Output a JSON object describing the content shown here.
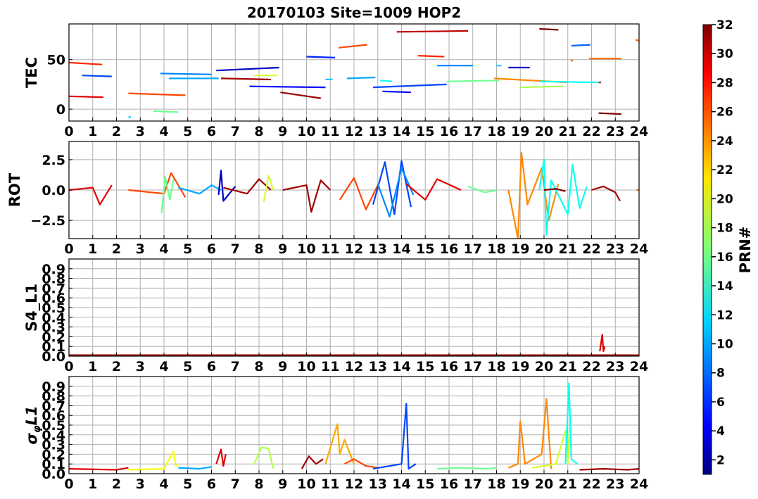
{
  "title": "20170103 Site=1009 HOP2",
  "colorbar": {
    "label": "PRN#",
    "min": 1,
    "max": 32,
    "ticks": [
      2,
      4,
      6,
      8,
      10,
      12,
      14,
      16,
      18,
      20,
      22,
      24,
      26,
      28,
      30,
      32
    ],
    "colormap": "jet"
  },
  "chart_data": [
    {
      "type": "line",
      "id": "tec",
      "ylabel": "TEC",
      "xlim": [
        0,
        24
      ],
      "ylim": [
        -12,
        86
      ],
      "xticks": [
        0,
        1,
        2,
        3,
        4,
        5,
        6,
        7,
        8,
        9,
        10,
        11,
        12,
        13,
        14,
        15,
        16,
        17,
        18,
        19,
        20,
        21,
        22,
        23,
        24
      ],
      "yticks": [
        0,
        50
      ],
      "ytick_labels": [
        "0",
        "50"
      ],
      "grid": true,
      "series": [
        {
          "prn": 27,
          "x": [
            0.0,
            1.4
          ],
          "y": [
            47,
            45
          ]
        },
        {
          "prn": 29,
          "x": [
            0.0,
            1.45
          ],
          "y": [
            13,
            12
          ]
        },
        {
          "prn": 7,
          "x": [
            0.55,
            1.8
          ],
          "y": [
            34,
            33
          ]
        },
        {
          "prn": 11,
          "x": [
            2.5,
            2.6
          ],
          "y": [
            -8,
            -8
          ]
        },
        {
          "prn": 26,
          "x": [
            2.5,
            4.9
          ],
          "y": [
            16,
            14
          ]
        },
        {
          "prn": 16,
          "x": [
            3.55,
            4.6
          ],
          "y": [
            -2,
            -3
          ]
        },
        {
          "prn": 9,
          "x": [
            3.85,
            6.0
          ],
          "y": [
            36,
            35
          ]
        },
        {
          "prn": 10,
          "x": [
            4.2,
            6.3
          ],
          "y": [
            31,
            31
          ]
        },
        {
          "prn": 3,
          "x": [
            6.2,
            8.85
          ],
          "y": [
            39,
            42
          ]
        },
        {
          "prn": 31,
          "x": [
            6.4,
            8.5
          ],
          "y": [
            31,
            30
          ]
        },
        {
          "prn": 19,
          "x": [
            7.8,
            8.8
          ],
          "y": [
            34,
            34
          ]
        },
        {
          "prn": 5,
          "x": [
            7.6,
            10.8
          ],
          "y": [
            23,
            22
          ]
        },
        {
          "prn": 31,
          "x": [
            8.9,
            10.6
          ],
          "y": [
            17,
            11
          ]
        },
        {
          "prn": 6,
          "x": [
            10.0,
            11.2
          ],
          "y": [
            53,
            52
          ]
        },
        {
          "prn": 26,
          "x": [
            11.35,
            12.55
          ],
          "y": [
            62,
            65
          ]
        },
        {
          "prn": 11,
          "x": [
            10.8,
            11.1
          ],
          "y": [
            30,
            30
          ]
        },
        {
          "prn": 10,
          "x": [
            11.7,
            12.9
          ],
          "y": [
            31,
            32
          ]
        },
        {
          "prn": 7,
          "x": [
            12.8,
            15.9
          ],
          "y": [
            22,
            25
          ]
        },
        {
          "prn": 13,
          "x": [
            13.1,
            13.6
          ],
          "y": [
            29,
            28
          ]
        },
        {
          "prn": 5,
          "x": [
            13.2,
            14.4
          ],
          "y": [
            18,
            17
          ]
        },
        {
          "prn": 30,
          "x": [
            13.8,
            16.8
          ],
          "y": [
            78,
            79
          ]
        },
        {
          "prn": 27,
          "x": [
            14.7,
            15.8
          ],
          "y": [
            54,
            53
          ]
        },
        {
          "prn": 9,
          "x": [
            15.5,
            17.0
          ],
          "y": [
            44,
            44
          ]
        },
        {
          "prn": 16,
          "x": [
            15.9,
            18.1
          ],
          "y": [
            28,
            29
          ]
        },
        {
          "prn": 11,
          "x": [
            18.0,
            18.2
          ],
          "y": [
            44,
            44
          ]
        },
        {
          "prn": 24,
          "x": [
            17.9,
            21.0
          ],
          "y": [
            31,
            27
          ]
        },
        {
          "prn": 3,
          "x": [
            18.5,
            19.4
          ],
          "y": [
            42,
            42
          ]
        },
        {
          "prn": 18,
          "x": [
            19.0,
            20.8
          ],
          "y": [
            22,
            23
          ]
        },
        {
          "prn": 13,
          "x": [
            19.8,
            22.3
          ],
          "y": [
            28,
            27
          ]
        },
        {
          "prn": 32,
          "x": [
            19.8,
            20.6
          ],
          "y": [
            81,
            80
          ]
        },
        {
          "prn": 8,
          "x": [
            21.15,
            21.95
          ],
          "y": [
            64,
            65
          ]
        },
        {
          "prn": 25,
          "x": [
            21.15,
            21.2
          ],
          "y": [
            48,
            50
          ]
        },
        {
          "prn": 25,
          "x": [
            21.9,
            23.25
          ],
          "y": [
            51,
            51
          ]
        },
        {
          "prn": 30,
          "x": [
            22.3,
            22.4
          ],
          "y": [
            27,
            27
          ]
        },
        {
          "prn": 32,
          "x": [
            22.3,
            23.25
          ],
          "y": [
            -4,
            -5
          ]
        },
        {
          "prn": 25,
          "x": [
            23.85,
            24.0
          ],
          "y": [
            70,
            69
          ]
        }
      ]
    },
    {
      "type": "line",
      "id": "rot",
      "ylabel": "ROT",
      "xlim": [
        0,
        24
      ],
      "ylim": [
        -4,
        4
      ],
      "xticks": [
        0,
        1,
        2,
        3,
        4,
        5,
        6,
        7,
        8,
        9,
        10,
        11,
        12,
        13,
        14,
        15,
        16,
        17,
        18,
        19,
        20,
        21,
        22,
        23,
        24
      ],
      "yticks": [
        -2.5,
        0.0,
        2.5
      ],
      "ytick_labels": [
        "−2.5",
        "0.0",
        "2.5"
      ],
      "grid": true,
      "series": [
        {
          "prn": 29,
          "x": [
            0,
            1.0,
            1.3,
            1.8
          ],
          "y": [
            0,
            0.2,
            -1.2,
            0.4
          ]
        },
        {
          "prn": 26,
          "x": [
            2.5,
            4.0,
            4.3,
            4.9
          ],
          "y": [
            0,
            -0.3,
            1.4,
            -0.6
          ]
        },
        {
          "prn": 16,
          "x": [
            3.9,
            4.05,
            4.25,
            4.4
          ],
          "y": [
            -1.9,
            1.1,
            -0.8,
            0.9
          ]
        },
        {
          "prn": 10,
          "x": [
            4.6,
            5.5,
            6.0,
            6.4
          ],
          "y": [
            0.2,
            -0.3,
            0.4,
            0
          ]
        },
        {
          "prn": 3,
          "x": [
            6.3,
            6.4,
            6.5,
            7.0
          ],
          "y": [
            -0.4,
            1.6,
            -0.9,
            0.3
          ]
        },
        {
          "prn": 31,
          "x": [
            6.5,
            7.5,
            8.0,
            8.5
          ],
          "y": [
            0.2,
            -0.3,
            0.9,
            0
          ]
        },
        {
          "prn": 19,
          "x": [
            8.2,
            8.4,
            8.6
          ],
          "y": [
            -1.0,
            1.2,
            0
          ]
        },
        {
          "prn": 31,
          "x": [
            9.0,
            10.0,
            10.2,
            10.6,
            11.0
          ],
          "y": [
            0,
            0.4,
            -1.8,
            0.8,
            0
          ]
        },
        {
          "prn": 26,
          "x": [
            11.4,
            12.0,
            12.5,
            13.0
          ],
          "y": [
            -0.8,
            1.0,
            -1.6,
            0.4
          ]
        },
        {
          "prn": 7,
          "x": [
            12.8,
            13.3,
            13.7,
            14.0,
            14.4
          ],
          "y": [
            -1.2,
            2.3,
            -2.0,
            2.4,
            -1.4
          ]
        },
        {
          "prn": 9,
          "x": [
            13.0,
            13.5,
            14.0,
            14.5
          ],
          "y": [
            0.5,
            -2.2,
            1.8,
            -0.4
          ]
        },
        {
          "prn": 29,
          "x": [
            14.2,
            15.0,
            15.5,
            16.5
          ],
          "y": [
            0.5,
            -0.8,
            0.9,
            0
          ]
        },
        {
          "prn": 16,
          "x": [
            16.8,
            17.5,
            18.0
          ],
          "y": [
            0.3,
            -0.2,
            0
          ]
        },
        {
          "prn": 24,
          "x": [
            18.5,
            18.9,
            19.05,
            19.3,
            19.9,
            20.2,
            20.6
          ],
          "y": [
            0,
            -4.0,
            3.1,
            -1.2,
            1.8,
            -2.5,
            0.5
          ]
        },
        {
          "prn": 13,
          "x": [
            19.8,
            20.0,
            20.1,
            20.3,
            21.0,
            21.2,
            21.5,
            21.8
          ],
          "y": [
            0,
            2.5,
            -3.7,
            0.8,
            -2.0,
            2.1,
            -1.5,
            0.3
          ]
        },
        {
          "prn": 32,
          "x": [
            20.0,
            20.5,
            20.9
          ],
          "y": [
            0,
            0.1,
            -0.1
          ]
        },
        {
          "prn": 31,
          "x": [
            22.0,
            22.5,
            23.0,
            23.2
          ],
          "y": [
            0,
            0.3,
            -0.2,
            -0.9
          ]
        },
        {
          "prn": 25,
          "x": [
            23.9,
            24.0
          ],
          "y": [
            0,
            0
          ]
        }
      ]
    },
    {
      "type": "line",
      "id": "s4",
      "ylabel": "S4_L1",
      "xlim": [
        0,
        24
      ],
      "ylim": [
        0,
        1.0
      ],
      "xticks": [
        0,
        1,
        2,
        3,
        4,
        5,
        6,
        7,
        8,
        9,
        10,
        11,
        12,
        13,
        14,
        15,
        16,
        17,
        18,
        19,
        20,
        21,
        22,
        23,
        24
      ],
      "yticks": [
        0.0,
        0.1,
        0.2,
        0.3,
        0.4,
        0.5,
        0.6,
        0.7,
        0.8,
        0.9
      ],
      "ytick_labels": [
        "0.0",
        "0.1",
        "0.2",
        "0.3",
        "0.4",
        "0.5",
        "0.6",
        "0.7",
        "0.8",
        "0.9"
      ],
      "grid": true,
      "series": [
        {
          "prn": 31,
          "x": [
            0,
            24
          ],
          "y": [
            0.01,
            0.01
          ]
        },
        {
          "prn": 29,
          "x": [
            22.35,
            22.45,
            22.5,
            22.55
          ],
          "y": [
            0.05,
            0.22,
            0.05,
            0.1
          ]
        }
      ]
    },
    {
      "type": "line",
      "id": "sigma",
      "ylabel": "σφL1",
      "xlim": [
        0,
        24
      ],
      "ylim": [
        0,
        1.0
      ],
      "xticks": [
        0,
        1,
        2,
        3,
        4,
        5,
        6,
        7,
        8,
        9,
        10,
        11,
        12,
        13,
        14,
        15,
        16,
        17,
        18,
        19,
        20,
        21,
        22,
        23,
        24
      ],
      "yticks": [
        0.0,
        0.1,
        0.2,
        0.3,
        0.4,
        0.5,
        0.6,
        0.7,
        0.8,
        0.9
      ],
      "ytick_labels": [
        "0.0",
        "0.1",
        "0.2",
        "0.3",
        "0.4",
        "0.5",
        "0.6",
        "0.7",
        "0.8",
        "0.9"
      ],
      "grid": true,
      "series": [
        {
          "prn": 29,
          "x": [
            0,
            2.0,
            2.5
          ],
          "y": [
            0.05,
            0.04,
            0.06
          ]
        },
        {
          "prn": 20,
          "x": [
            2.5,
            4.0,
            4.4,
            4.5,
            4.6
          ],
          "y": [
            0.04,
            0.05,
            0.23,
            0.08,
            0.1
          ]
        },
        {
          "prn": 10,
          "x": [
            4.6,
            5.5,
            6.0
          ],
          "y": [
            0.06,
            0.05,
            0.07
          ]
        },
        {
          "prn": 29,
          "x": [
            6.2,
            6.4,
            6.5,
            6.6
          ],
          "y": [
            0.1,
            0.25,
            0.08,
            0.2
          ]
        },
        {
          "prn": 18,
          "x": [
            7.8,
            8.1,
            8.4,
            8.6
          ],
          "y": [
            0.1,
            0.27,
            0.26,
            0.05
          ]
        },
        {
          "prn": 31,
          "x": [
            9.8,
            10.1,
            10.4,
            10.7
          ],
          "y": [
            0.05,
            0.18,
            0.1,
            0.15
          ]
        },
        {
          "prn": 23,
          "x": [
            10.8,
            11.3,
            11.4,
            11.6,
            12.0
          ],
          "y": [
            0.1,
            0.51,
            0.2,
            0.35,
            0.1
          ]
        },
        {
          "prn": 26,
          "x": [
            11.6,
            12.0,
            12.5,
            13.0
          ],
          "y": [
            0.1,
            0.15,
            0.08,
            0.06
          ]
        },
        {
          "prn": 7,
          "x": [
            12.8,
            14.0,
            14.2,
            14.3,
            14.6
          ],
          "y": [
            0.05,
            0.1,
            0.72,
            0.05,
            0.1
          ]
        },
        {
          "prn": 16,
          "x": [
            15.5,
            16.5,
            17.5,
            18.0
          ],
          "y": [
            0.05,
            0.06,
            0.05,
            0.06
          ]
        },
        {
          "prn": 24,
          "x": [
            18.5,
            18.9,
            19.0,
            19.2,
            19.9,
            20.1,
            20.3
          ],
          "y": [
            0.06,
            0.1,
            0.54,
            0.1,
            0.2,
            0.77,
            0.05
          ]
        },
        {
          "prn": 19,
          "x": [
            19.5,
            20.5,
            20.9,
            21.0,
            21.1
          ],
          "y": [
            0.06,
            0.1,
            0.44,
            0.1,
            0.58
          ]
        },
        {
          "prn": 13,
          "x": [
            20.9,
            21.05,
            21.15,
            21.4
          ],
          "y": [
            0.1,
            0.93,
            0.15,
            0.1
          ]
        },
        {
          "prn": 31,
          "x": [
            21.5,
            22.5,
            23.5,
            24.0
          ],
          "y": [
            0.04,
            0.05,
            0.04,
            0.05
          ]
        }
      ]
    }
  ]
}
